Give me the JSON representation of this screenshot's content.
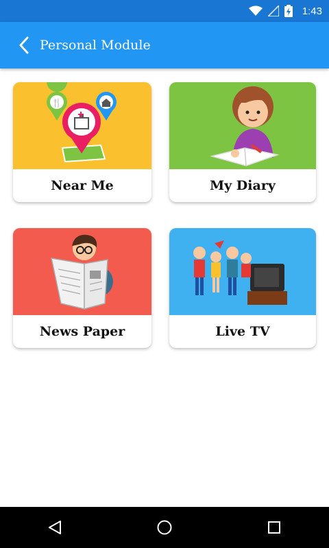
{
  "status": {
    "time": "1:43"
  },
  "appbar": {
    "title": "Personal Module"
  },
  "cards": [
    {
      "label": "Near Me",
      "color": "#fbc02d"
    },
    {
      "label": "My Diary",
      "color": "#7cc442"
    },
    {
      "label": "News Paper",
      "color": "#f25b4e"
    },
    {
      "label": "Live TV",
      "color": "#3fb0f0"
    }
  ],
  "icons": {
    "status": [
      "wifi-icon",
      "signal-icon",
      "battery-icon"
    ],
    "back": "back-arrow-icon",
    "nav": [
      "nav-back-icon",
      "nav-home-icon",
      "nav-recents-icon"
    ]
  },
  "colors": {
    "statusbar": "#1976d2",
    "appbar": "#2196f3"
  }
}
